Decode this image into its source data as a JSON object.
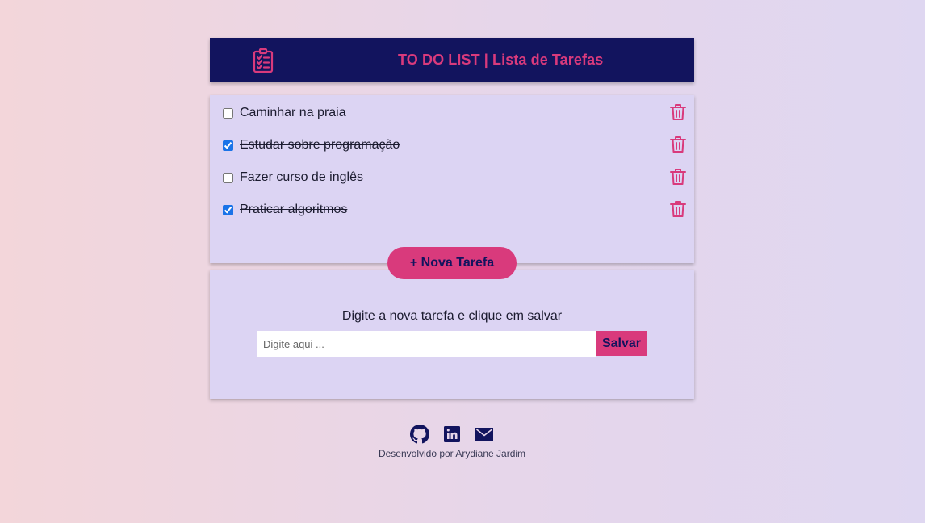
{
  "header": {
    "title": "TO DO LIST | Lista de Tarefas",
    "logo_icon": "clipboard-list-icon"
  },
  "tasks": [
    {
      "label": "Caminhar na praia",
      "done": false
    },
    {
      "label": "Estudar sobre programação",
      "done": true
    },
    {
      "label": "Fazer curso de inglês",
      "done": false
    },
    {
      "label": "Praticar algoritmos",
      "done": true
    }
  ],
  "new_task_button": "+ Nova Tarefa",
  "form": {
    "hint": "Digite a nova tarefa e clique em salvar",
    "input_placeholder": "Digite aqui ...",
    "input_value": "",
    "save_label": "Salvar"
  },
  "footer": {
    "icons": [
      "github-icon",
      "linkedin-icon",
      "mail-icon"
    ],
    "credit": "Desenvolvido por Arydiane Jardim"
  },
  "colors": {
    "navy": "#12145e",
    "pink": "#d93a7c",
    "card": "#dcd4f3"
  }
}
